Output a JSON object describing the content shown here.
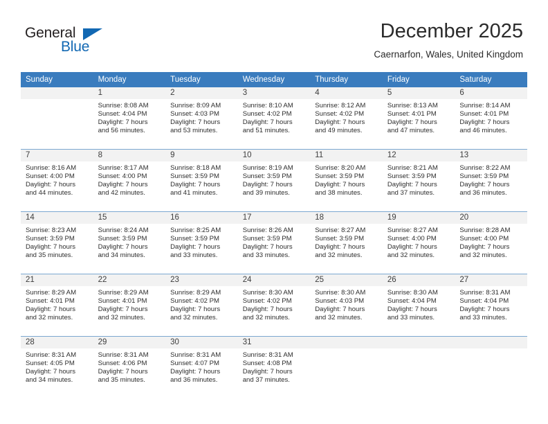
{
  "brand": {
    "name_part1": "General",
    "name_part2": "Blue",
    "accent_color": "#1268b3"
  },
  "header": {
    "month_title": "December 2025",
    "location": "Caernarfon, Wales, United Kingdom"
  },
  "theme": {
    "header_row_color": "#3a7cbe",
    "daynum_bg": "#f2f2f2",
    "grid_line": "#7ba7d0"
  },
  "weekday_headers": [
    "Sunday",
    "Monday",
    "Tuesday",
    "Wednesday",
    "Thursday",
    "Friday",
    "Saturday"
  ],
  "weeks": [
    [
      {
        "day": "",
        "blank": true,
        "sunrise": "",
        "sunset": "",
        "daylight_line1": "",
        "daylight_line2": ""
      },
      {
        "day": "1",
        "sunrise": "Sunrise: 8:08 AM",
        "sunset": "Sunset: 4:04 PM",
        "daylight_line1": "Daylight: 7 hours",
        "daylight_line2": "and 56 minutes."
      },
      {
        "day": "2",
        "sunrise": "Sunrise: 8:09 AM",
        "sunset": "Sunset: 4:03 PM",
        "daylight_line1": "Daylight: 7 hours",
        "daylight_line2": "and 53 minutes."
      },
      {
        "day": "3",
        "sunrise": "Sunrise: 8:10 AM",
        "sunset": "Sunset: 4:02 PM",
        "daylight_line1": "Daylight: 7 hours",
        "daylight_line2": "and 51 minutes."
      },
      {
        "day": "4",
        "sunrise": "Sunrise: 8:12 AM",
        "sunset": "Sunset: 4:02 PM",
        "daylight_line1": "Daylight: 7 hours",
        "daylight_line2": "and 49 minutes."
      },
      {
        "day": "5",
        "sunrise": "Sunrise: 8:13 AM",
        "sunset": "Sunset: 4:01 PM",
        "daylight_line1": "Daylight: 7 hours",
        "daylight_line2": "and 47 minutes."
      },
      {
        "day": "6",
        "sunrise": "Sunrise: 8:14 AM",
        "sunset": "Sunset: 4:01 PM",
        "daylight_line1": "Daylight: 7 hours",
        "daylight_line2": "and 46 minutes."
      }
    ],
    [
      {
        "day": "7",
        "sunrise": "Sunrise: 8:16 AM",
        "sunset": "Sunset: 4:00 PM",
        "daylight_line1": "Daylight: 7 hours",
        "daylight_line2": "and 44 minutes."
      },
      {
        "day": "8",
        "sunrise": "Sunrise: 8:17 AM",
        "sunset": "Sunset: 4:00 PM",
        "daylight_line1": "Daylight: 7 hours",
        "daylight_line2": "and 42 minutes."
      },
      {
        "day": "9",
        "sunrise": "Sunrise: 8:18 AM",
        "sunset": "Sunset: 3:59 PM",
        "daylight_line1": "Daylight: 7 hours",
        "daylight_line2": "and 41 minutes."
      },
      {
        "day": "10",
        "sunrise": "Sunrise: 8:19 AM",
        "sunset": "Sunset: 3:59 PM",
        "daylight_line1": "Daylight: 7 hours",
        "daylight_line2": "and 39 minutes."
      },
      {
        "day": "11",
        "sunrise": "Sunrise: 8:20 AM",
        "sunset": "Sunset: 3:59 PM",
        "daylight_line1": "Daylight: 7 hours",
        "daylight_line2": "and 38 minutes."
      },
      {
        "day": "12",
        "sunrise": "Sunrise: 8:21 AM",
        "sunset": "Sunset: 3:59 PM",
        "daylight_line1": "Daylight: 7 hours",
        "daylight_line2": "and 37 minutes."
      },
      {
        "day": "13",
        "sunrise": "Sunrise: 8:22 AM",
        "sunset": "Sunset: 3:59 PM",
        "daylight_line1": "Daylight: 7 hours",
        "daylight_line2": "and 36 minutes."
      }
    ],
    [
      {
        "day": "14",
        "sunrise": "Sunrise: 8:23 AM",
        "sunset": "Sunset: 3:59 PM",
        "daylight_line1": "Daylight: 7 hours",
        "daylight_line2": "and 35 minutes."
      },
      {
        "day": "15",
        "sunrise": "Sunrise: 8:24 AM",
        "sunset": "Sunset: 3:59 PM",
        "daylight_line1": "Daylight: 7 hours",
        "daylight_line2": "and 34 minutes."
      },
      {
        "day": "16",
        "sunrise": "Sunrise: 8:25 AM",
        "sunset": "Sunset: 3:59 PM",
        "daylight_line1": "Daylight: 7 hours",
        "daylight_line2": "and 33 minutes."
      },
      {
        "day": "17",
        "sunrise": "Sunrise: 8:26 AM",
        "sunset": "Sunset: 3:59 PM",
        "daylight_line1": "Daylight: 7 hours",
        "daylight_line2": "and 33 minutes."
      },
      {
        "day": "18",
        "sunrise": "Sunrise: 8:27 AM",
        "sunset": "Sunset: 3:59 PM",
        "daylight_line1": "Daylight: 7 hours",
        "daylight_line2": "and 32 minutes."
      },
      {
        "day": "19",
        "sunrise": "Sunrise: 8:27 AM",
        "sunset": "Sunset: 4:00 PM",
        "daylight_line1": "Daylight: 7 hours",
        "daylight_line2": "and 32 minutes."
      },
      {
        "day": "20",
        "sunrise": "Sunrise: 8:28 AM",
        "sunset": "Sunset: 4:00 PM",
        "daylight_line1": "Daylight: 7 hours",
        "daylight_line2": "and 32 minutes."
      }
    ],
    [
      {
        "day": "21",
        "sunrise": "Sunrise: 8:29 AM",
        "sunset": "Sunset: 4:01 PM",
        "daylight_line1": "Daylight: 7 hours",
        "daylight_line2": "and 32 minutes."
      },
      {
        "day": "22",
        "sunrise": "Sunrise: 8:29 AM",
        "sunset": "Sunset: 4:01 PM",
        "daylight_line1": "Daylight: 7 hours",
        "daylight_line2": "and 32 minutes."
      },
      {
        "day": "23",
        "sunrise": "Sunrise: 8:29 AM",
        "sunset": "Sunset: 4:02 PM",
        "daylight_line1": "Daylight: 7 hours",
        "daylight_line2": "and 32 minutes."
      },
      {
        "day": "24",
        "sunrise": "Sunrise: 8:30 AM",
        "sunset": "Sunset: 4:02 PM",
        "daylight_line1": "Daylight: 7 hours",
        "daylight_line2": "and 32 minutes."
      },
      {
        "day": "25",
        "sunrise": "Sunrise: 8:30 AM",
        "sunset": "Sunset: 4:03 PM",
        "daylight_line1": "Daylight: 7 hours",
        "daylight_line2": "and 32 minutes."
      },
      {
        "day": "26",
        "sunrise": "Sunrise: 8:30 AM",
        "sunset": "Sunset: 4:04 PM",
        "daylight_line1": "Daylight: 7 hours",
        "daylight_line2": "and 33 minutes."
      },
      {
        "day": "27",
        "sunrise": "Sunrise: 8:31 AM",
        "sunset": "Sunset: 4:04 PM",
        "daylight_line1": "Daylight: 7 hours",
        "daylight_line2": "and 33 minutes."
      }
    ],
    [
      {
        "day": "28",
        "sunrise": "Sunrise: 8:31 AM",
        "sunset": "Sunset: 4:05 PM",
        "daylight_line1": "Daylight: 7 hours",
        "daylight_line2": "and 34 minutes."
      },
      {
        "day": "29",
        "sunrise": "Sunrise: 8:31 AM",
        "sunset": "Sunset: 4:06 PM",
        "daylight_line1": "Daylight: 7 hours",
        "daylight_line2": "and 35 minutes."
      },
      {
        "day": "30",
        "sunrise": "Sunrise: 8:31 AM",
        "sunset": "Sunset: 4:07 PM",
        "daylight_line1": "Daylight: 7 hours",
        "daylight_line2": "and 36 minutes."
      },
      {
        "day": "31",
        "sunrise": "Sunrise: 8:31 AM",
        "sunset": "Sunset: 4:08 PM",
        "daylight_line1": "Daylight: 7 hours",
        "daylight_line2": "and 37 minutes."
      },
      {
        "day": "",
        "blank": true,
        "sunrise": "",
        "sunset": "",
        "daylight_line1": "",
        "daylight_line2": ""
      },
      {
        "day": "",
        "blank": true,
        "sunrise": "",
        "sunset": "",
        "daylight_line1": "",
        "daylight_line2": ""
      },
      {
        "day": "",
        "blank": true,
        "sunrise": "",
        "sunset": "",
        "daylight_line1": "",
        "daylight_line2": ""
      }
    ]
  ]
}
